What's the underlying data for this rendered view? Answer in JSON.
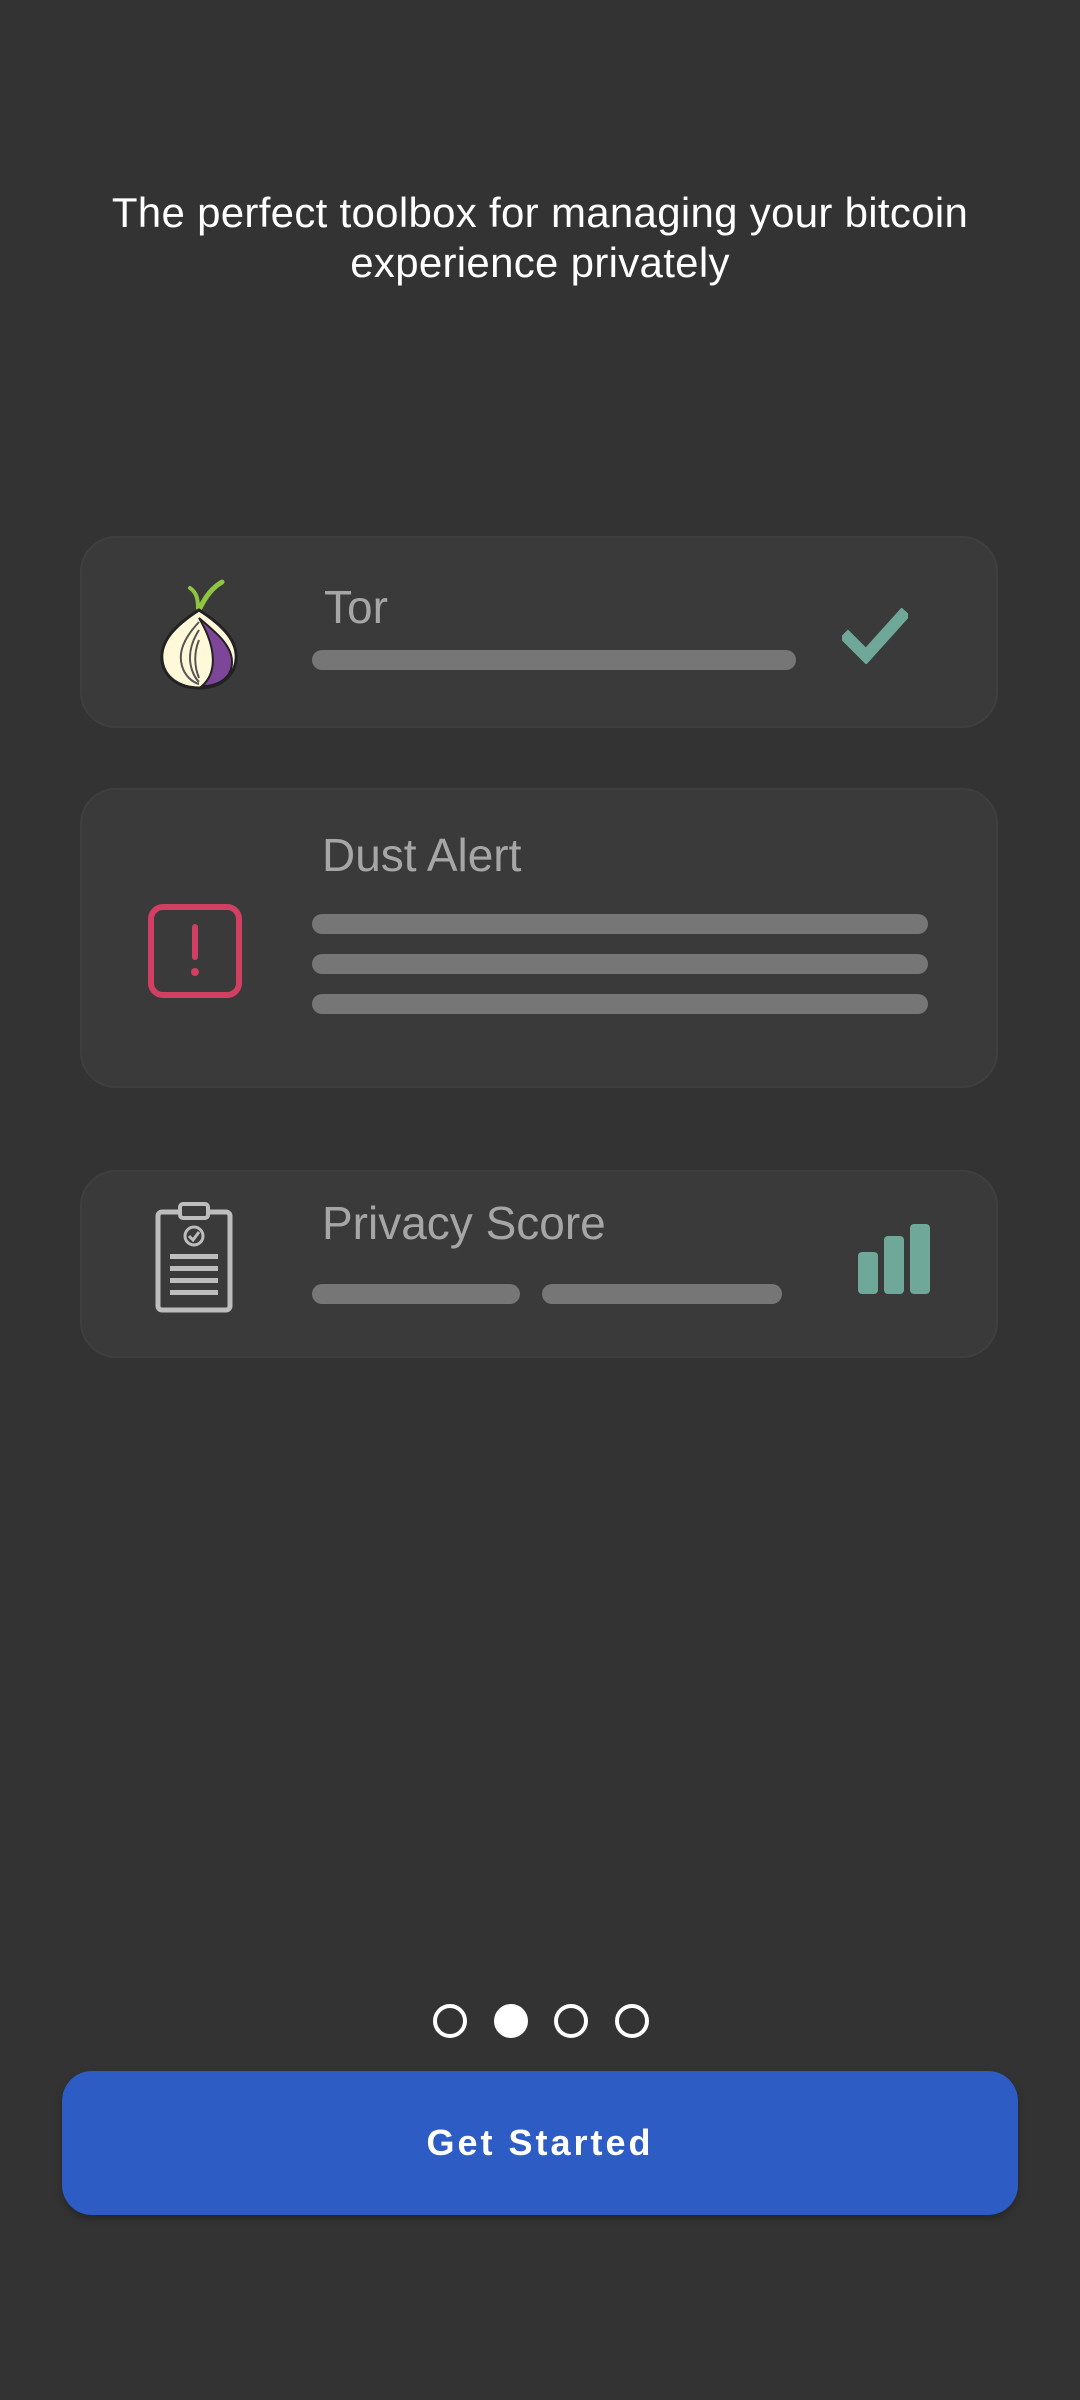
{
  "headline": "The perfect toolbox for managing your bitcoin experience privately",
  "cards": [
    {
      "title": "Tor",
      "icon": "tor-onion-icon",
      "status_icon": "checkmark-icon"
    },
    {
      "title": "Dust Alert",
      "icon": "alert-icon"
    },
    {
      "title": "Privacy Score",
      "icon": "clipboard-icon",
      "status_icon": "bar-chart-icon"
    }
  ],
  "pager": {
    "count": 4,
    "active_index": 1
  },
  "cta_label": "Get Started",
  "colors": {
    "background": "#333333",
    "card": "#3a3a3a",
    "accent_green": "#6fa898",
    "alert_red": "#d13f63",
    "button_blue": "#2d5cc5"
  }
}
